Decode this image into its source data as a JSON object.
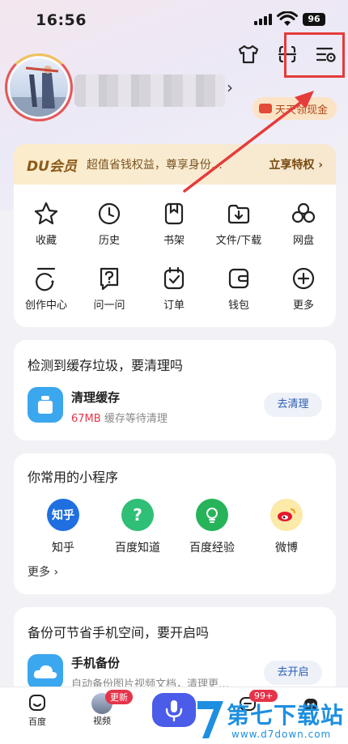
{
  "status_bar": {
    "time": "16:56",
    "battery": "96"
  },
  "profile": {
    "gold_label": "天天领现金"
  },
  "vip": {
    "brand": "DU会员",
    "desc": "超值省钱权益，尊享身份…",
    "link": "立享特权 ›"
  },
  "grid": [
    {
      "label": "收藏",
      "icon": "star-icon"
    },
    {
      "label": "历史",
      "icon": "clock-icon"
    },
    {
      "label": "书架",
      "icon": "bookshelf-icon"
    },
    {
      "label": "文件/下载",
      "icon": "download-icon"
    },
    {
      "label": "网盘",
      "icon": "cloud-drive-icon"
    },
    {
      "label": "创作中心",
      "icon": "create-icon"
    },
    {
      "label": "问一问",
      "icon": "question-icon"
    },
    {
      "label": "订单",
      "icon": "order-icon"
    },
    {
      "label": "钱包",
      "icon": "wallet-icon"
    },
    {
      "label": "更多",
      "icon": "plus-icon"
    }
  ],
  "cache": {
    "title": "检测到缓存垃圾，要清理吗",
    "item": "清理缓存",
    "size": "67MB",
    "size_desc": "缓存等待清理",
    "button": "去清理"
  },
  "mini": {
    "title": "你常用的小程序",
    "items": [
      {
        "label": "知乎",
        "glyph": "知乎",
        "color": "#1f6fe0"
      },
      {
        "label": "百度知道",
        "glyph": "?",
        "color": "#2fbf76"
      },
      {
        "label": "百度经验",
        "glyph": "",
        "color": "#26b35a"
      },
      {
        "label": "微博",
        "glyph": "",
        "color": "#f5b21d"
      }
    ],
    "more": "更多 ›"
  },
  "backup": {
    "title": "备份可节省手机空间，要开启吗",
    "item": "手机备份",
    "desc": "自动备份图片视频文档，清理更…",
    "button": "去开启"
  },
  "tabbar": {
    "home": "百度",
    "video": "视频",
    "video_badge": "更新",
    "msg_badge": "99+"
  },
  "watermark": {
    "brand": "第七下载站",
    "url": "www.d7down.com"
  },
  "colors": {
    "accent": "#4a5ce8",
    "highlight": "#e53b3b"
  }
}
